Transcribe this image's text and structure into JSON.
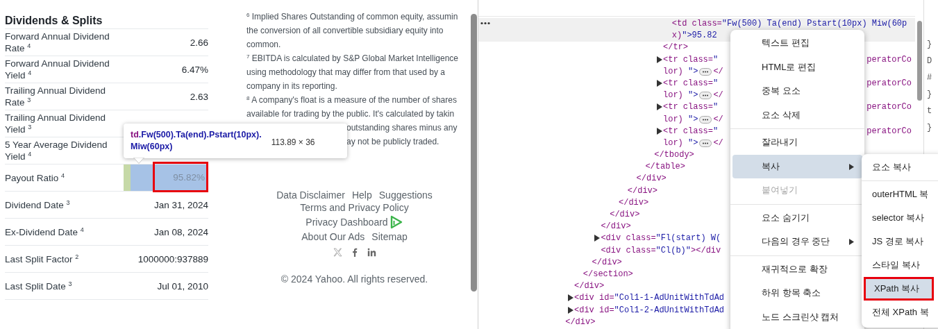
{
  "dividends": {
    "title": "Dividends & Splits",
    "rows": [
      {
        "label": "Forward Annual Dividend Rate $^{4}$",
        "value": "2.66"
      },
      {
        "label": "Forward Annual Dividend Yield $^{4}$",
        "value": "6.47%"
      },
      {
        "label": "Trailing Annual Dividend Rate $^{3}$",
        "value": "2.63"
      },
      {
        "label": "Trailing Annual Dividend Yield $^{3}$"
      },
      {
        "label": "5 Year Average Dividend Yield $^{4}$"
      },
      {
        "label": "Payout Ratio $^{4}$",
        "value": "95.82%",
        "inspected": true,
        "annotated": true
      },
      {
        "label": "Dividend Date $^{3}$",
        "value": "Jan 31, 2024"
      },
      {
        "label": "Ex-Dividend Date $^{4}$",
        "value": "Jan 08, 2024"
      },
      {
        "label": "Last Split Factor $^{2}$",
        "value": "1000000:937889"
      },
      {
        "label": "Last Split Date $^{3}$",
        "value": "Jul 01, 2010"
      }
    ]
  },
  "footnotes": [
    {
      "text": "$^{6}$ Implied Shares Outstanding of common equity, assumin"
    },
    {
      "text": "the conversion of all convertible subsidiary equity into"
    },
    {
      "text": "common."
    },
    {
      "text": "$^{7}$ EBITDA is calculated by S&P Global Market Intelligence"
    },
    {
      "text": "using methodology that may differ from that used by a"
    },
    {
      "text": "company in its reporting."
    },
    {
      "text": "$^{8}$ A company's float is a measure of the number of shares"
    },
    {
      "text": "available for trading by the public. It's calculated by takin"
    },
    {
      "text": "outstanding shares minus any",
      "behind_tooltip": true
    },
    {
      "text": "ay not be publicly traded.",
      "behind_tooltip": true
    }
  ],
  "footer": {
    "link_rows": [
      [
        {
          "label": "Data Disclaimer"
        },
        {
          "label": "Help"
        },
        {
          "label": "Suggestions"
        }
      ],
      [
        {
          "label": "Terms and Privacy Policy"
        }
      ],
      [
        {
          "label": "Privacy Dashboard",
          "badge": true
        }
      ],
      [
        {
          "label": "About Our Ads"
        },
        {
          "label": "Sitemap"
        }
      ]
    ],
    "social": [
      {
        "kind": "x"
      },
      {
        "kind": "facebook"
      },
      {
        "kind": "linkedin"
      }
    ],
    "copyright": "© 2024 Yahoo. All rights reserved."
  },
  "tooltip": {
    "selector_lines": [
      "td.Fw(500).Ta(end).Pstart(10px).",
      "Miw(60px)"
    ],
    "size": "113.89 × 36"
  },
  "devtools": {
    "tree": [
      {
        "children": [
          {
            "children": [
              {
                "children": [
                  {
                    "children": [
                      {
                        "children": [
                          {
                            "children": [
                              {
                                "children": [
                                  {
                                    "children": [
                                      {
                                        "children": [
                                          {
                                            "children": [
                                              {
                                                "children": [
                                                  {
                                                    "children": [
                                                      {
                                                        "selected": true,
                                                        "lines": [
                                                          {
                                                            "text": "<td class=\"Fw(500) Ta(end) Pstart(10px) Miw(60p"
                                                          },
                                                          {
                                                            "text": "x)\">95.82"
                                                          }
                                                        ]
                                                      }
                                                    ]
                                                  },
                                                  {
                                                    "lines": [
                                                      {
                                                        "text": "</tr>"
                                                      }
                                                    ]
                                                  },
                                                  {
                                                    "expandable": true,
                                                    "lines": [
                                                      {
                                                        "text": "<tr class=\"",
                                                        "tail": "peratorCo"
                                                      },
                                                      {
                                                        "text": "lor) \">",
                                                        "chip": true,
                                                        "after": "</"
                                                      }
                                                    ]
                                                  },
                                                  {
                                                    "expandable": true,
                                                    "lines": [
                                                      {
                                                        "text": "<tr class=\"",
                                                        "tail": "peratorCo"
                                                      },
                                                      {
                                                        "text": "lor) \">",
                                                        "chip": true,
                                                        "after": "</"
                                                      }
                                                    ]
                                                  },
                                                  {
                                                    "expandable": true,
                                                    "lines": [
                                                      {
                                                        "text": "<tr class=\"",
                                                        "tail": "peratorCo"
                                                      },
                                                      {
                                                        "text": "lor) \">",
                                                        "chip": true,
                                                        "after": "</"
                                                      }
                                                    ]
                                                  },
                                                  {
                                                    "expandable": true,
                                                    "lines": [
                                                      {
                                                        "text": "<tr class=\"",
                                                        "tail": "peratorCo"
                                                      },
                                                      {
                                                        "text": "lor) \">",
                                                        "chip": true,
                                                        "after": "</"
                                                      }
                                                    ]
                                                  }
                                                ]
                                              },
                                              {
                                                "lines": [
                                                  {
                                                    "text": "</tbody>"
                                                  }
                                                ]
                                              }
                                            ]
                                          },
                                          {
                                            "lines": [
                                              {
                                                "text": "</table>"
                                              }
                                            ]
                                          }
                                        ]
                                      },
                                      {
                                        "lines": [
                                          {
                                            "text": "</div>"
                                          }
                                        ]
                                      }
                                    ]
                                  },
                                  {
                                    "lines": [
                                      {
                                        "text": "</div>"
                                      }
                                    ]
                                  }
                                ]
                              },
                              {
                                "lines": [
                                  {
                                    "text": "</div>"
                                  }
                                ]
                              }
                            ]
                          },
                          {
                            "lines": [
                              {
                                "text": "</div>"
                              }
                            ]
                          }
                        ]
                      },
                      {
                        "lines": [
                          {
                            "text": "</div>"
                          }
                        ]
                      },
                      {
                        "expandable": true,
                        "lines": [
                          {
                            "text": "<div class=\"Fl(start) W("
                          }
                        ]
                      },
                      {
                        "lines": [
                          {
                            "text": "<div class=\"Cl(b)\"></div"
                          }
                        ]
                      }
                    ]
                  },
                  {
                    "lines": [
                      {
                        "text": "</div>"
                      }
                    ]
                  }
                ]
              },
              {
                "lines": [
                  {
                    "text": "</section>"
                  }
                ]
              }
            ]
          },
          {
            "lines": [
              {
                "text": "</div>"
              }
            ]
          },
          {
            "expandable": true,
            "lines": [
              {
                "text": "<div id=\"Col1-1-AdUnitWithTdAd"
              }
            ]
          },
          {
            "expandable": true,
            "lines": [
              {
                "text": "<div id=\"Col1-2-AdUnitWithTdAd"
              }
            ]
          }
        ]
      },
      {
        "lines": [
          {
            "text": "</div>"
          }
        ]
      }
    ],
    "styles_fragments": [
      "}",
      "D",
      "#",
      "}",
      "t",
      "}"
    ],
    "context_menu": [
      {
        "kind": "item",
        "label": "텍스트 편집",
        "selected": false,
        "disabled": false,
        "submenu": false
      },
      {
        "kind": "item",
        "label": "HTML로 편집",
        "selected": false,
        "disabled": false,
        "submenu": false
      },
      {
        "kind": "item",
        "label": "중복 요소",
        "selected": false,
        "disabled": false,
        "submenu": false
      },
      {
        "kind": "item",
        "label": "요소 삭제",
        "selected": false,
        "disabled": false,
        "submenu": false
      },
      {
        "kind": "divider"
      },
      {
        "kind": "item",
        "label": "잘라내기",
        "selected": false,
        "disabled": false,
        "submenu": false
      },
      {
        "kind": "item",
        "label": "복사",
        "selected": true,
        "disabled": false,
        "submenu": true
      },
      {
        "kind": "item",
        "label": "붙여넣기",
        "selected": false,
        "disabled": true,
        "submenu": false
      },
      {
        "kind": "divider"
      },
      {
        "kind": "item",
        "label": "요소 숨기기",
        "selected": false,
        "disabled": false,
        "submenu": false
      },
      {
        "kind": "item",
        "label": "다음의 경우 중단",
        "selected": false,
        "disabled": false,
        "submenu": true
      },
      {
        "kind": "divider"
      },
      {
        "kind": "item",
        "label": "재귀적으로 확장",
        "selected": false,
        "disabled": false,
        "submenu": false
      },
      {
        "kind": "item",
        "label": "하위 항목 축소",
        "selected": false,
        "disabled": false,
        "submenu": false
      },
      {
        "kind": "item",
        "label": "노드 스크린샷 캡처",
        "selected": false,
        "disabled": false,
        "submenu": false
      }
    ],
    "copy_submenu": [
      {
        "kind": "item",
        "label": "요소 복사",
        "selected": false,
        "annotated": false
      },
      {
        "kind": "divider"
      },
      {
        "kind": "item",
        "label": "outerHTML 복",
        "selected": false,
        "annotated": false
      },
      {
        "kind": "item",
        "label": "selector 복사",
        "selected": false,
        "annotated": false
      },
      {
        "kind": "item",
        "label": "JS 경로 복사",
        "selected": false,
        "annotated": false
      },
      {
        "kind": "item",
        "label": "스타일 복사",
        "selected": false,
        "annotated": false
      },
      {
        "kind": "item",
        "label": "XPath 복사",
        "selected": true,
        "annotated": true
      },
      {
        "kind": "item",
        "label": "전체 XPath 복",
        "selected": false,
        "annotated": false
      }
    ]
  }
}
